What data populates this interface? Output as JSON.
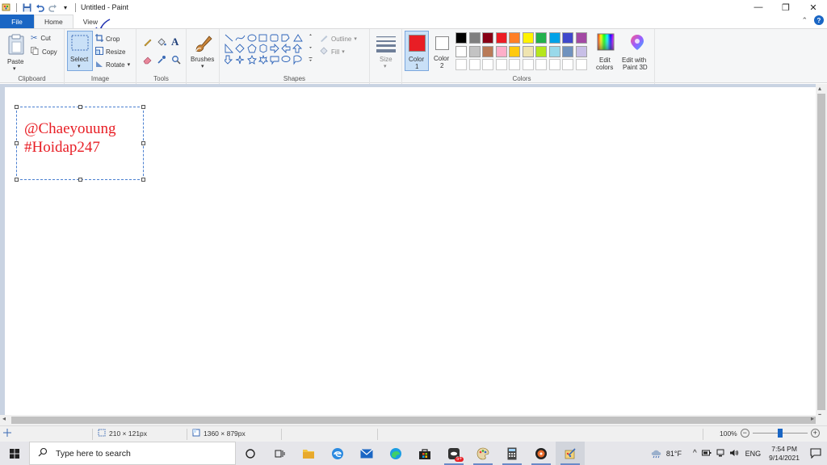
{
  "window": {
    "title": "Untitled - Paint",
    "controls": {
      "minimize": "—",
      "restore": "❐",
      "close": "✕"
    }
  },
  "tabs": [
    {
      "label": "File"
    },
    {
      "label": "Home"
    },
    {
      "label": "View"
    }
  ],
  "ribbon": {
    "clipboard": {
      "label": "Clipboard",
      "paste": "Paste",
      "cut": "Cut",
      "copy": "Copy"
    },
    "image": {
      "label": "Image",
      "select": "Select",
      "crop": "Crop",
      "resize": "Resize",
      "rotate": "Rotate"
    },
    "tools": {
      "label": "Tools"
    },
    "brushes": {
      "label": "Brushes"
    },
    "shapes": {
      "label": "Shapes",
      "outline": "Outline",
      "fill": "Fill"
    },
    "size": {
      "label": "Size"
    },
    "color1": {
      "label": "Color",
      "index": "1",
      "value": "#e81e25"
    },
    "color2": {
      "label": "Color",
      "index": "2",
      "value": "#ffffff"
    },
    "colors": {
      "label": "Colors",
      "row1": [
        "#000000",
        "#7f7f7f",
        "#880015",
        "#ed1c24",
        "#ff7f27",
        "#fff200",
        "#22b14c",
        "#00a2e8",
        "#3f48cc",
        "#a349a4"
      ],
      "row2": [
        "#ffffff",
        "#c3c3c3",
        "#b97a57",
        "#ffaec9",
        "#ffc90e",
        "#efe4b0",
        "#b5e61d",
        "#99d9ea",
        "#7092be",
        "#c8bfe7"
      ],
      "row3_empty_count": 10
    },
    "edit_colors": {
      "line1": "Edit",
      "line2": "colors"
    },
    "paint3d": {
      "line1": "Edit with",
      "line2": "Paint 3D"
    }
  },
  "canvas": {
    "text_line1": "@Chaeyouung",
    "text_line2": "#Hoidap247"
  },
  "status": {
    "selection_size": "210 × 121px",
    "image_size": "1360 × 879px",
    "zoom": "100%",
    "zoom_level_fraction": 0.5
  },
  "taskbar": {
    "search_placeholder": "Type here to search",
    "weather": "81°F",
    "language": "ENG",
    "time": "7:54 PM",
    "date": "9/14/2021",
    "badge": "5+"
  }
}
